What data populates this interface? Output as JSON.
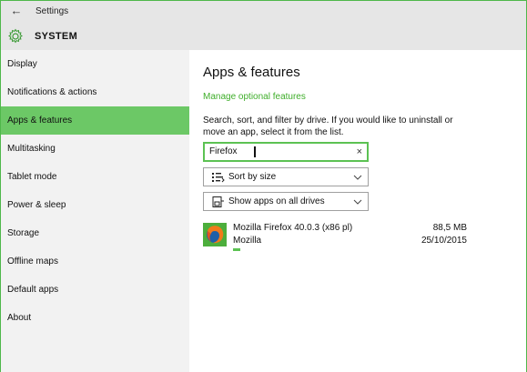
{
  "window": {
    "app_title": "Settings",
    "back_glyph": "←",
    "section_title": "SYSTEM",
    "section_icon": "gear-icon",
    "accent_color": "#6cc866",
    "link_color": "#3fae2a"
  },
  "sidebar": {
    "items": [
      {
        "label": "Display",
        "active": false
      },
      {
        "label": "Notifications & actions",
        "active": false
      },
      {
        "label": "Apps & features",
        "active": true
      },
      {
        "label": "Multitasking",
        "active": false
      },
      {
        "label": "Tablet mode",
        "active": false
      },
      {
        "label": "Power & sleep",
        "active": false
      },
      {
        "label": "Storage",
        "active": false
      },
      {
        "label": "Offline maps",
        "active": false
      },
      {
        "label": "Default apps",
        "active": false
      },
      {
        "label": "About",
        "active": false
      }
    ]
  },
  "main": {
    "title": "Apps & features",
    "optional_link": "Manage optional features",
    "description": "Search, sort, and filter by drive. If you would like to uninstall or move an app, select it from the list.",
    "search": {
      "value": "Firefox",
      "clear_glyph": "×"
    },
    "sort_dropdown": {
      "label": "Sort by size",
      "icon": "sort-icon"
    },
    "drive_dropdown": {
      "label": "Show apps on all drives",
      "icon": "drive-icon"
    },
    "apps": [
      {
        "name": "Mozilla Firefox 40.0.3 (x86 pl)",
        "publisher": "Mozilla",
        "size": "88,5 MB",
        "date": "25/10/2015",
        "icon": "firefox-icon"
      }
    ]
  }
}
